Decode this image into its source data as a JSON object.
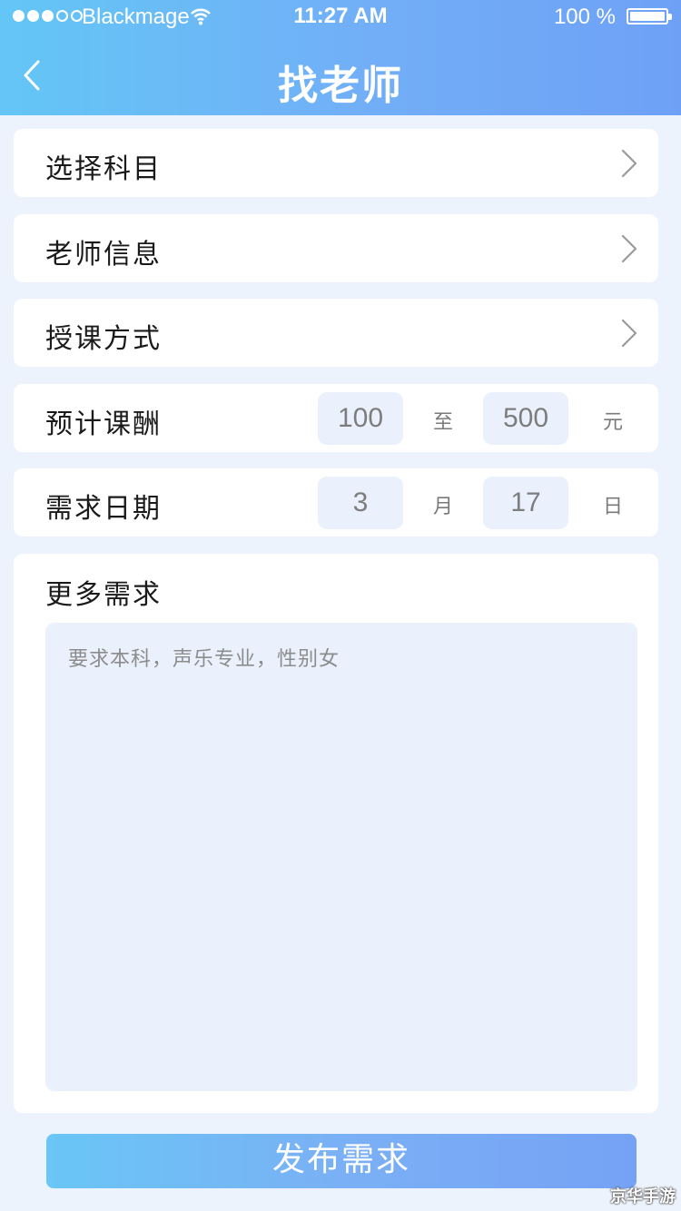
{
  "status_bar": {
    "carrier": "Blackmage",
    "time": "11:27 AM",
    "battery": "100 %",
    "signal_bars_filled": 3,
    "signal_bars_total": 5
  },
  "header": {
    "title": "找老师",
    "back_icon": "chevron-left-icon"
  },
  "form": {
    "subject_label": "选择科目",
    "teacher_info_label": "老师信息",
    "teaching_mode_label": "授课方式",
    "fee": {
      "label": "预计课酬",
      "min": "100",
      "separator": "至",
      "max": "500",
      "unit": "元"
    },
    "date": {
      "label": "需求日期",
      "month": "3",
      "month_unit": "月",
      "day": "17",
      "day_unit": "日"
    },
    "more": {
      "label": "更多需求",
      "placeholder": "要求本科，声乐专业，性别女"
    }
  },
  "submit_label": "发布需求",
  "watermark": "京华手游",
  "colors": {
    "header_start": "#63c6f6",
    "header_end": "#6ea1f6",
    "page_bg": "#edf3fc",
    "input_bg": "#eaf1fc"
  }
}
